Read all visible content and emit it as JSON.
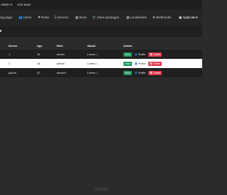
{
  "topbar": {
    "user_label": "Admin ▾",
    "join_label": "Join team"
  },
  "nav": [
    {
      "icon": "",
      "label": "ing page"
    },
    {
      "icon": "👥",
      "label": "Users"
    },
    {
      "icon": "⚑",
      "label": "Roles"
    },
    {
      "icon": "☰",
      "label": "Servers"
    },
    {
      "icon": "▦",
      "label": "Store"
    },
    {
      "icon": "🛒",
      "label": "Store packages"
    },
    {
      "icon": "▦",
      "label": "Localization"
    },
    {
      "icon": "⚙",
      "label": "Webhooks"
    },
    {
      "icon": "▣",
      "label": "Application"
    }
  ],
  "table": {
    "columns": [
      "Server",
      "Age",
      "Role",
      "About",
      "Action"
    ],
    "rows": [
      {
        "server": "1",
        "age": "18",
        "role": "admin",
        "about": "Lorem i...",
        "style": "dark"
      },
      {
        "server": "1",
        "age": "18",
        "role": "admin",
        "about": "Lorem i...",
        "style": "light"
      },
      {
        "server": "global",
        "age": "22",
        "role": "discord",
        "about": "Lorem i...",
        "style": "dark"
      }
    ],
    "actions": {
      "view": "View",
      "profile": "Profile",
      "delete": "Delete"
    }
  },
  "footer": {
    "text": "DEMO"
  }
}
